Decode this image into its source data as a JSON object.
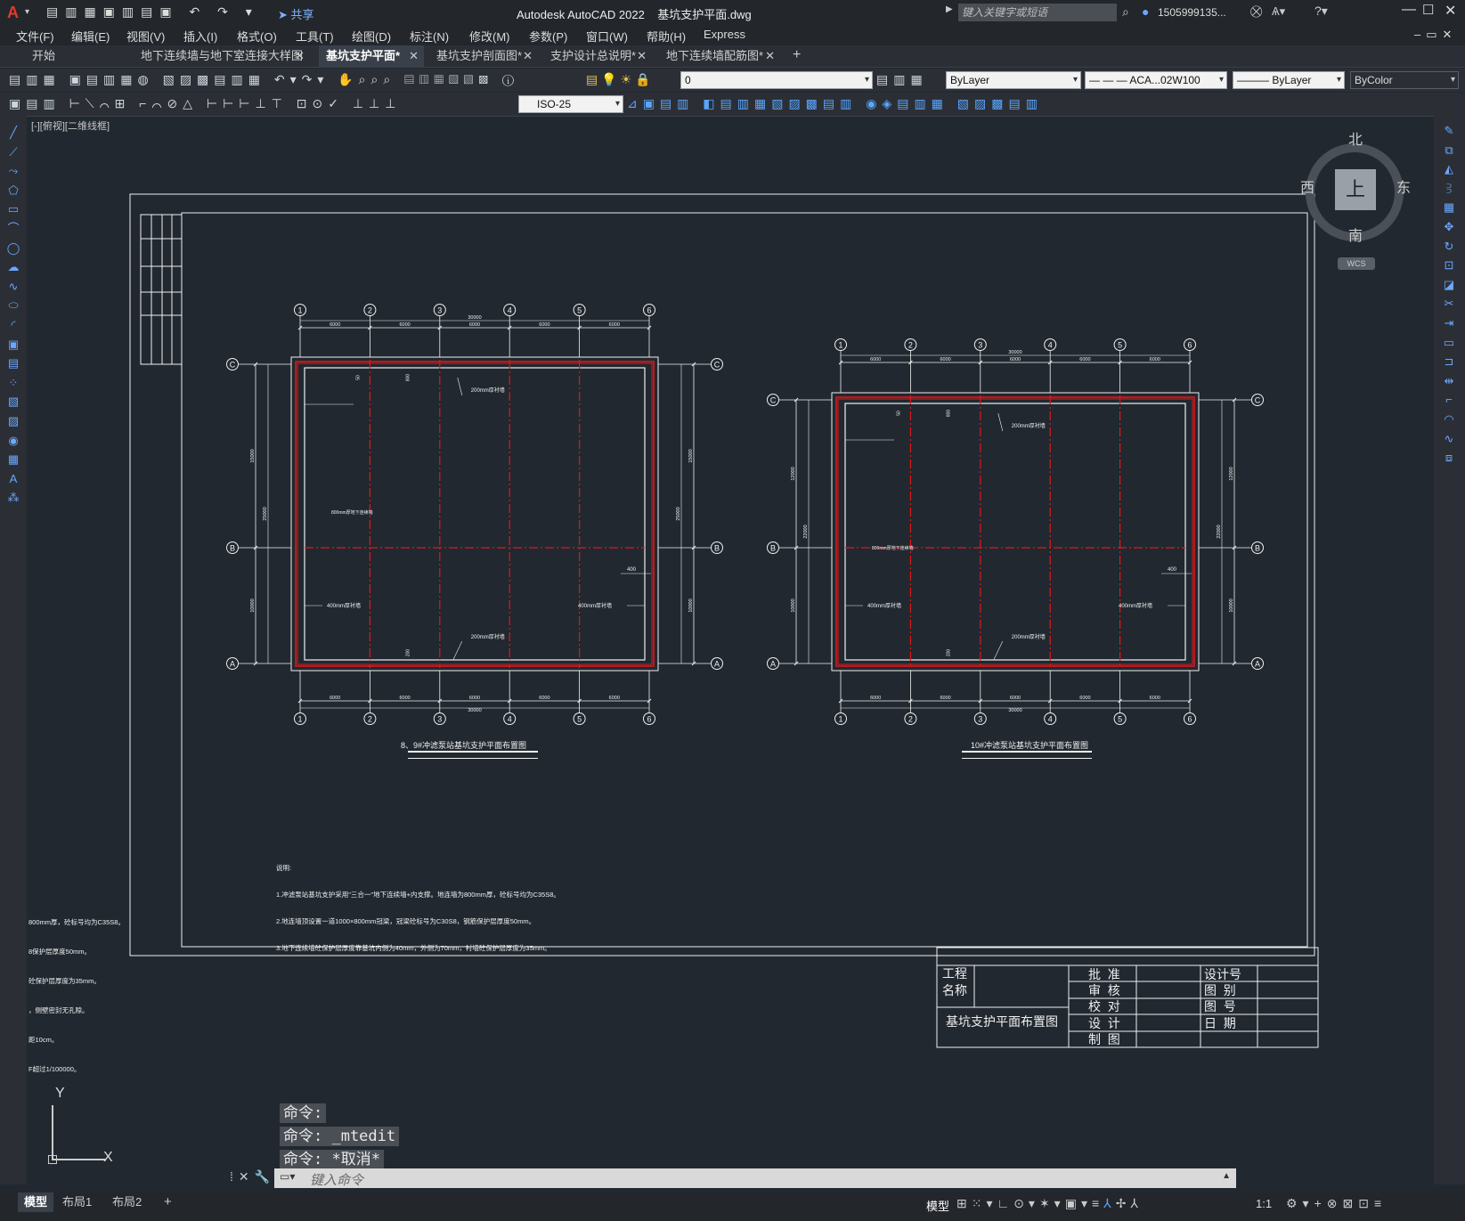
{
  "app": {
    "title": "Autodesk AutoCAD 2022    基坑支护平面.dwg",
    "search_placeholder": "键入关键字或短语",
    "user": "1505999135...",
    "share": "共享"
  },
  "menu": [
    "文件(F)",
    "编辑(E)",
    "视图(V)",
    "插入(I)",
    "格式(O)",
    "工具(T)",
    "绘图(D)",
    "标注(N)",
    "修改(M)",
    "参数(P)",
    "窗口(W)",
    "帮助(H)",
    "Express"
  ],
  "tabs": [
    {
      "label": "开始",
      "closable": false,
      "active": false
    },
    {
      "label": "地下连续墙与地下室连接大样图",
      "closable": true,
      "active": false
    },
    {
      "label": "基坑支护平面*",
      "closable": true,
      "active": true
    },
    {
      "label": "基坑支护剖面图*",
      "closable": true,
      "active": false
    },
    {
      "label": "支护设计总说明*",
      "closable": true,
      "active": false
    },
    {
      "label": "地下连续墙配筋图*",
      "closable": true,
      "active": false
    }
  ],
  "toolbar": {
    "layer_value": "0",
    "color_value": "ByLayer",
    "linetype_value": "ACA...02W100",
    "lineweight_value": "ByLayer",
    "plotstyle_value": "ByColor",
    "dimstyle_value": "ISO-25"
  },
  "viewport_label": "[-][俯视][二维线框]",
  "viewcube": {
    "north": "北",
    "south": "南",
    "east": "东",
    "west": "西",
    "top": "上",
    "wcs": "WCS"
  },
  "drawing": {
    "left_plan": {
      "title": "8、9#冲滤泵站基坑支护平面布置图",
      "axes_x": [
        "1",
        "2",
        "3",
        "4",
        "5",
        "6"
      ],
      "axes_y": [
        "C",
        "B",
        "A"
      ],
      "total_width": "30000",
      "bay": "6000",
      "height_total": "25000",
      "height_top": "15000",
      "height_bottom": "10000",
      "label_wall_top": "200mm厚衬墙",
      "label_wall_bottom": "200mm厚衬墙",
      "label_diaphragm": "800mm厚地下连续墙",
      "label_side_left": "400mm厚衬墙",
      "label_side_right": "400mm厚衬墙",
      "dim_400": "400",
      "dim_50": "50",
      "dim_800": "800",
      "dim_200": "200"
    },
    "right_plan": {
      "title": "10#冲滤泵站基坑支护平面布置图",
      "axes_x": [
        "1",
        "2",
        "3",
        "4",
        "5",
        "6"
      ],
      "axes_y": [
        "C",
        "B",
        "A"
      ],
      "total_width": "30000",
      "bay": "6000",
      "height_total": "22000",
      "height_top": "12000",
      "height_bottom": "10000",
      "label_wall_top": "200mm厚衬墙",
      "label_wall_bottom": "200mm厚衬墙",
      "label_diaphragm": "800mm厚地下连续墙",
      "label_side_left": "400mm厚衬墙",
      "label_side_right": "400mm厚衬墙",
      "dim_400": "400",
      "dim_50": "50",
      "dim_800": "800",
      "dim_200": "200"
    },
    "notes": [
      "说明:",
      "1.冲滤泵站基坑支护采用\"三合一\"地下连续墙+内支撑。地连墙为800mm厚，砼标号均为C35S8。",
      "2.地连墙顶设置一道1000×800mm冠梁，冠梁砼标号为C30S8，钢筋保护层厚度50mm。",
      "3.地下连续墙砼保护层厚度靠基坑内侧为40mm，外侧为70mm，衬墙砼保护层厚度为35mm。"
    ],
    "left_notes": [
      "800mm厚，砼标号均为C35S8。",
      "8保护层厚度50mm。",
      "砼保护层厚度为35mm。",
      "，侧壁密封无孔隙。",
      "距10cm。",
      "F超过1/100000。"
    ],
    "title_block": {
      "project_label": "工程",
      "name_label": "名称",
      "drawing_name": "基坑支护平面布置图",
      "approve": "批  准",
      "review": "审  核",
      "check": "校  对",
      "design": "设  计",
      "draw": "制  图",
      "design_no": "设计号",
      "category": "图  别",
      "drawing_no": "图  号",
      "date": "日  期"
    }
  },
  "command": {
    "history": [
      "命令:",
      "命令: _mtedit",
      "命令: *取消*"
    ],
    "placeholder": "键入命令"
  },
  "status": {
    "layout_tabs": [
      "模型",
      "布局1",
      "布局2"
    ],
    "model": "模型",
    "scale": "1:1"
  },
  "ucs": {
    "x": "X",
    "y": "Y"
  },
  "colors": {
    "bg": "#212830",
    "red_axis": "#e01818",
    "line": "#f0f0f0"
  }
}
